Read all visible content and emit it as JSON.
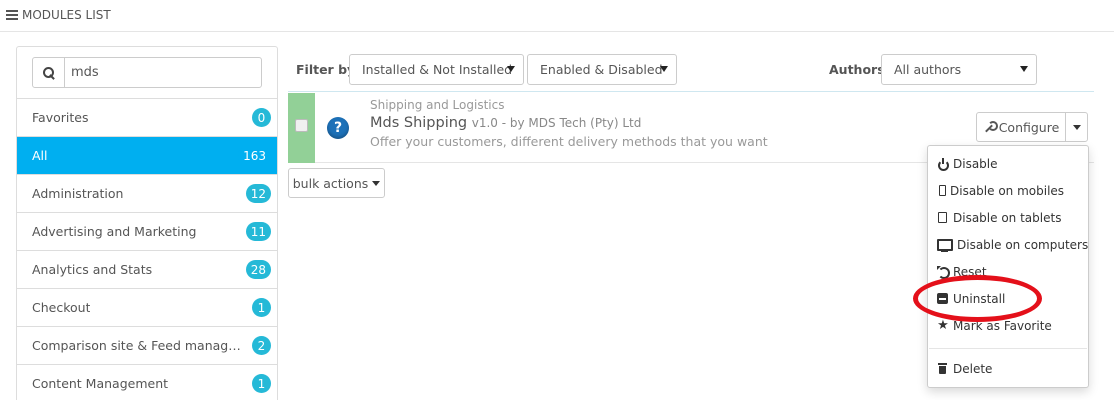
{
  "header": {
    "title": "MODULES LIST"
  },
  "sidebar": {
    "search": {
      "value": "mds"
    },
    "categories": [
      {
        "label": "Favorites",
        "count": "0"
      },
      {
        "label": "All",
        "count": "163"
      },
      {
        "label": "Administration",
        "count": "12"
      },
      {
        "label": "Advertising and Marketing",
        "count": "11"
      },
      {
        "label": "Analytics and Stats",
        "count": "28"
      },
      {
        "label": "Checkout",
        "count": "1"
      },
      {
        "label": "Comparison site & Feed manageme...",
        "count": "2"
      },
      {
        "label": "Content Management",
        "count": "1"
      }
    ]
  },
  "filters": {
    "filter_by_label": "Filter by",
    "install_status": "Installed & Not Installed",
    "enable_status": "Enabled & Disabled",
    "authors_label": "Authors",
    "authors_value": "All authors"
  },
  "module": {
    "category": "Shipping and Logistics",
    "name": "Mds Shipping",
    "version": "v1.0 - by MDS Tech (Pty) Ltd",
    "description": "Offer your customers, different delivery methods that you want",
    "help_glyph": "?",
    "configure_label": "Configure"
  },
  "bulk": {
    "label": "bulk actions"
  },
  "dropdown": {
    "items": [
      {
        "label": "Disable",
        "icon": "power-icon"
      },
      {
        "label": "Disable on mobiles",
        "icon": "mobile-icon"
      },
      {
        "label": "Disable on tablets",
        "icon": "tablet-icon"
      },
      {
        "label": "Disable on computers",
        "icon": "desktop-icon"
      },
      {
        "label": "Reset",
        "icon": "reset-icon"
      },
      {
        "label": "Uninstall",
        "icon": "minus-square-icon"
      },
      {
        "label": "Mark as Favorite",
        "icon": "star-icon"
      },
      {
        "label": "Delete",
        "icon": "trash-icon"
      }
    ]
  },
  "colors": {
    "accent": "#00aff0",
    "badge": "#25b9d7",
    "enabled_strip": "#92d097",
    "highlight": "#e4101a"
  }
}
